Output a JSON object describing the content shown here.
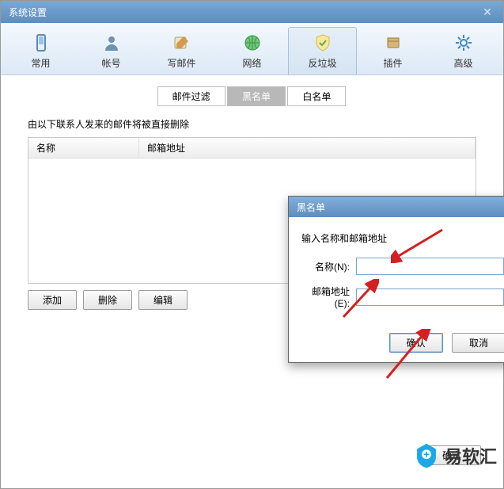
{
  "window": {
    "title": "系统设置"
  },
  "toolbar": [
    {
      "id": "general",
      "label": "常用",
      "icon": "phone-icon",
      "active": false
    },
    {
      "id": "account",
      "label": "帐号",
      "icon": "person-icon",
      "active": false
    },
    {
      "id": "compose",
      "label": "写邮件",
      "icon": "compose-icon",
      "active": false
    },
    {
      "id": "network",
      "label": "网络",
      "icon": "globe-icon",
      "active": false
    },
    {
      "id": "antispam",
      "label": "反垃圾",
      "icon": "shield-icon",
      "active": true
    },
    {
      "id": "plugin",
      "label": "插件",
      "icon": "plugin-icon",
      "active": false
    },
    {
      "id": "advanced",
      "label": "高级",
      "icon": "gear-icon",
      "active": false
    }
  ],
  "tabs": [
    {
      "id": "filter",
      "label": "邮件过滤",
      "active": false
    },
    {
      "id": "blacklist",
      "label": "黑名单",
      "active": true
    },
    {
      "id": "whitelist",
      "label": "白名单",
      "active": false
    }
  ],
  "blacklist": {
    "description": "由以下联系人发来的邮件将被直接删除",
    "columns": {
      "name": "名称",
      "email": "邮箱地址"
    },
    "rows": []
  },
  "actions": {
    "add": "添加",
    "remove": "删除",
    "edit": "编辑"
  },
  "ok": "确定",
  "dialog": {
    "title": "黑名单",
    "prompt": "输入名称和邮箱地址",
    "name_label": "名称(N):",
    "email_label": "邮箱地址(E):",
    "name_value": "",
    "email_value": "",
    "ok": "确认",
    "cancel": "取消"
  },
  "watermark": {
    "text": "易软汇"
  }
}
